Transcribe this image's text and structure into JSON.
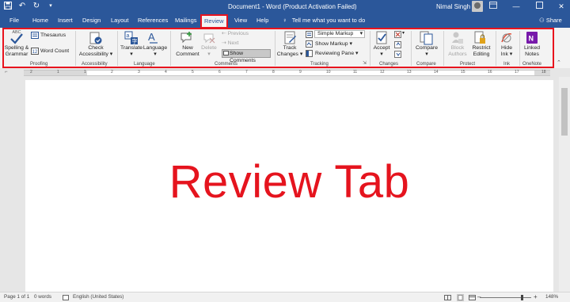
{
  "title_bar": {
    "document_title": "Document1 - Word (Product Activation Failed)",
    "user_name": "Nimal Singh",
    "icons": [
      "save-icon",
      "undo-icon",
      "redo-icon",
      "customize-qat-icon",
      "ribbon-display-icon",
      "minimize-icon",
      "maximize-icon",
      "close-icon"
    ]
  },
  "tabs": [
    {
      "label": "File"
    },
    {
      "label": "Home"
    },
    {
      "label": "Insert"
    },
    {
      "label": "Design"
    },
    {
      "label": "Layout"
    },
    {
      "label": "References"
    },
    {
      "label": "Mailings"
    },
    {
      "label": "Review",
      "active": true
    },
    {
      "label": "View"
    },
    {
      "label": "Help"
    }
  ],
  "tell_me": "Tell me what you want to do",
  "share": "Share",
  "ribbon": {
    "proofing": {
      "label": "Proofing",
      "spelling_line1": "Spelling &",
      "spelling_line2": "Grammar",
      "abc": "ABC",
      "thesaurus": "Thesaurus",
      "word_count": "Word Count"
    },
    "accessibility": {
      "label": "Accessibility",
      "check_line1": "Check",
      "check_line2": "Accessibility"
    },
    "language": {
      "label": "Language",
      "translate": "Translate",
      "language": "Language"
    },
    "comments": {
      "label": "Comments",
      "new_line1": "New",
      "new_line2": "Comment",
      "delete": "Delete",
      "previous": "Previous",
      "next": "Next",
      "show_comments": "Show Comments"
    },
    "tracking": {
      "label": "Tracking",
      "track_line1": "Track",
      "track_line2": "Changes",
      "markup_value": "Simple Markup",
      "show_markup": "Show Markup",
      "reviewing_pane": "Reviewing Pane"
    },
    "changes": {
      "label": "Changes",
      "accept": "Accept"
    },
    "compare": {
      "label": "Compare",
      "compare": "Compare"
    },
    "protect": {
      "label": "Protect",
      "block_line1": "Block",
      "block_line2": "Authors",
      "restrict_line1": "Restrict",
      "restrict_line2": "Editing"
    },
    "ink": {
      "label": "Ink",
      "hide_line1": "Hide",
      "hide_line2": "Ink"
    },
    "onenote": {
      "label": "OneNote",
      "linked_line1": "Linked",
      "linked_line2": "Notes"
    }
  },
  "ruler_numbers": [
    "2",
    "1",
    "1",
    "2",
    "3",
    "4",
    "5",
    "6",
    "7",
    "8",
    "9",
    "10",
    "11",
    "12",
    "13",
    "14",
    "15",
    "16",
    "17",
    "18"
  ],
  "document": {
    "headline": "Review Tab"
  },
  "status_bar": {
    "page": "Page 1 of 1",
    "words": "0 words",
    "language": "English (United States)",
    "zoom": "148%",
    "zoom_level": 1.48
  },
  "colors": {
    "title_bar": "#2b579a",
    "highlight": "#e8141e",
    "headline": "#e5141e",
    "ribbon_bg": "#f3f3f3"
  }
}
